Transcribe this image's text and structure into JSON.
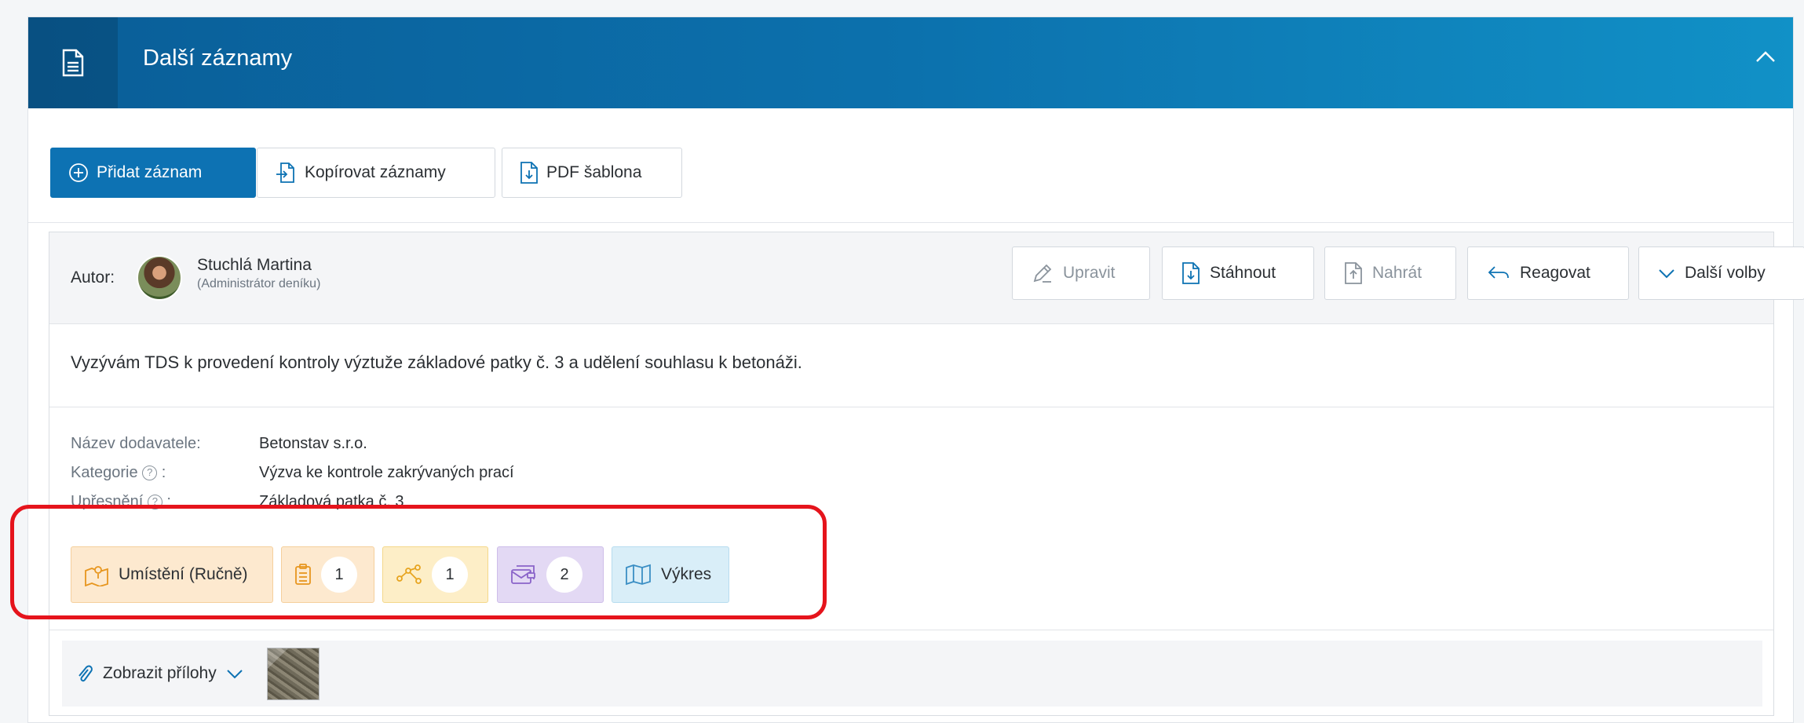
{
  "panel": {
    "title": "Další záznamy",
    "icon": "document-icon",
    "collapse_icon": "chevron-up-icon"
  },
  "toolbar": {
    "add_label": "Přidat záznam",
    "copy_label": "Kopírovat záznamy",
    "pdf_label": "PDF šablona"
  },
  "entry": {
    "author_label": "Autor:",
    "author_name": "Stuchlá Martina",
    "author_role": "(Administrátor deníku)",
    "actions": {
      "edit": "Upravit",
      "download": "Stáhnout",
      "upload": "Nahrát",
      "react": "Reagovat",
      "more": "Další volby"
    },
    "text": "Vyzývám TDS k provedení kontroly výztuže základové patky č. 3 a udělení souhlasu k betonáži.",
    "meta": {
      "supplier_label": "Název dodavatele:",
      "supplier_value": "Betonstav s.r.o.",
      "category_label": "Kategorie",
      "category_value": "Výzva ke kontrole zakrývaných prací",
      "detail_label": "Upřesnění",
      "detail_value": "Základová patka č. 3",
      "colon": " :"
    },
    "tags": {
      "location": "Umístění (Ručně)",
      "clipboard_count": "1",
      "network_count": "1",
      "messages_count": "2",
      "drawing": "Výkres"
    },
    "attachments": {
      "label": "Zobrazit přílohy"
    }
  },
  "colors": {
    "header_start": "#0a5e98",
    "header_end": "#1191c7",
    "primary": "#0d72b3",
    "highlight": "#e5141c"
  }
}
